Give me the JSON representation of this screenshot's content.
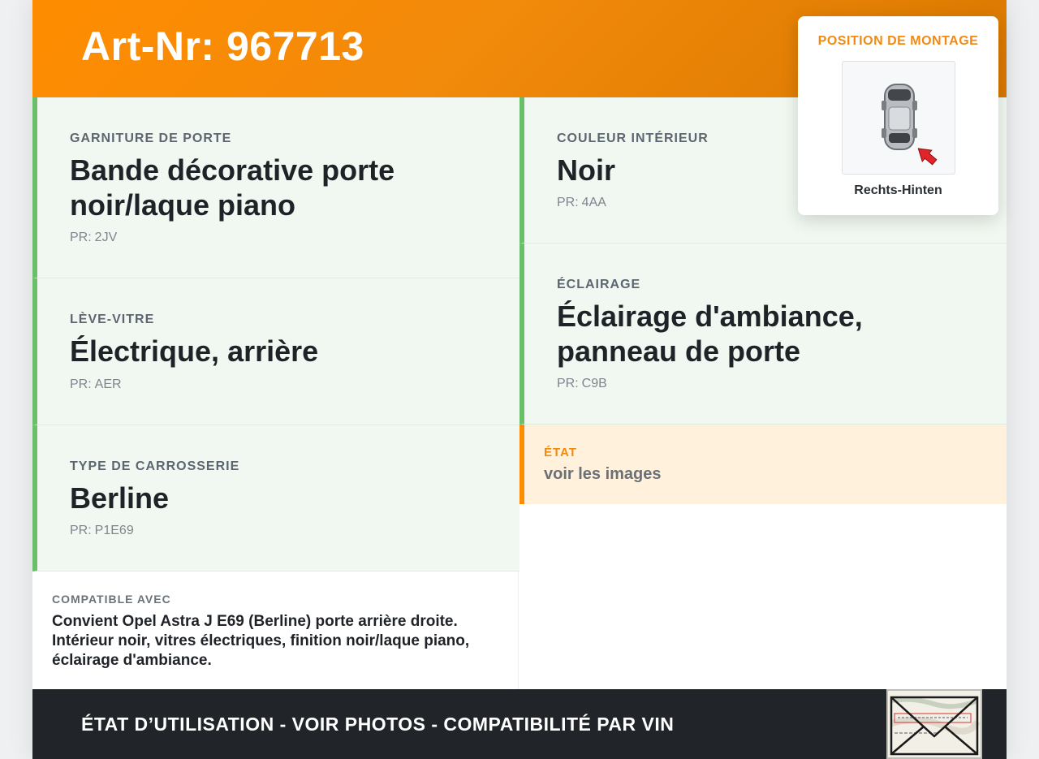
{
  "header": {
    "title": "Art-Nr: 967713"
  },
  "specs": [
    {
      "label": "GARNITURE DE PORTE",
      "value": "Bande décorative porte noir/laque piano",
      "pr_prefix": "PR:",
      "pr": "2JV"
    },
    {
      "label": "COULEUR INTÉRIEUR",
      "value": "Noir",
      "pr_prefix": "PR:",
      "pr": "4AA"
    },
    {
      "label": "LÈVE-VITRE",
      "value": "Électrique, arrière",
      "pr_prefix": "PR:",
      "pr": "AER"
    },
    {
      "label": "ÉCLAIRAGE",
      "value": "Éclairage d'ambiance, panneau de porte",
      "pr_prefix": "PR:",
      "pr": "C9B"
    },
    {
      "label": "TYPE DE CARROSSERIE",
      "value": "Berline",
      "pr_prefix": "PR:",
      "pr": "P1E69"
    }
  ],
  "etat": {
    "label": "ÉTAT",
    "value": "voir les images"
  },
  "compat": {
    "label": "COMPATIBLE AVEC",
    "text": "Convient Opel Astra J E69 (Berline) porte arrière droite. Intérieur noir, vitres électriques, finition noir/laque piano, éclairage d'ambiance."
  },
  "mount": {
    "label": "POSITION DE MONTAGE",
    "position": "Rechts-Hinten"
  },
  "footer": {
    "text": "ÉTAT D’UTILISATION - VOIR PHOTOS - COMPATIBILITÉ PAR VIN"
  },
  "colors": {
    "accent": "#ff8c00",
    "spec_border": "#6abf69",
    "footer_bg": "#212529",
    "spec_bg": "#f1f8f1",
    "etat_bg": "#fff1dc"
  }
}
